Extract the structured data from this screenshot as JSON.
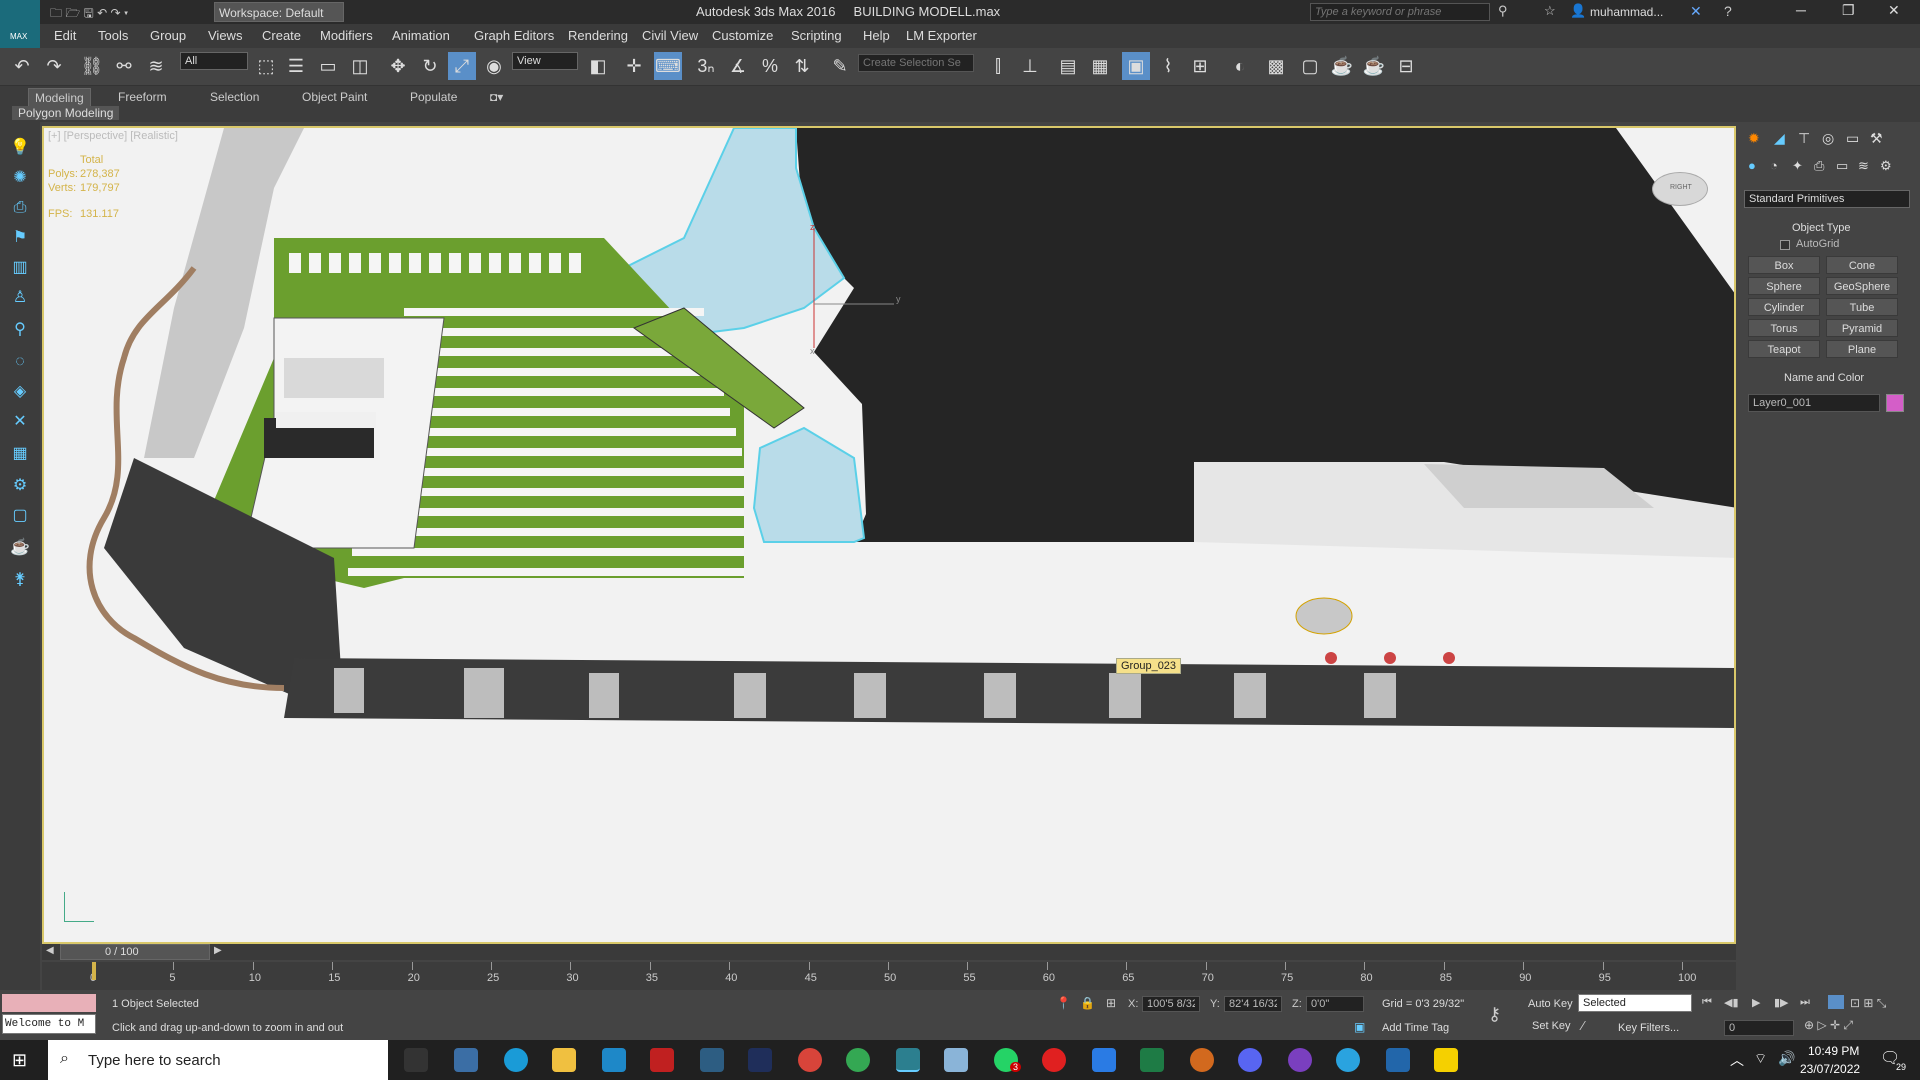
{
  "titlebar": {
    "workspace": "Workspace: Default",
    "title": "Autodesk 3ds Max 2016     BUILDING MODELL.max",
    "search_placeholder": "Type a keyword or phrase",
    "user": "muhammad...",
    "logo_text": "MAX"
  },
  "menu": [
    "Edit",
    "Tools",
    "Group",
    "Views",
    "Create",
    "Modifiers",
    "Animation",
    "Graph Editors",
    "Rendering",
    "Civil View",
    "Customize",
    "Scripting",
    "Help",
    "LM Exporter"
  ],
  "toolbar": {
    "filter_value": "All",
    "view_value": "View",
    "selection_set_placeholder": "Create Selection Se"
  },
  "ribbon": {
    "tabs": [
      "Modeling",
      "Freeform",
      "Selection",
      "Object Paint",
      "Populate"
    ],
    "sub_label": "Polygon Modeling"
  },
  "viewport": {
    "label": "[+] [Perspective] [Realistic]",
    "stats": {
      "total_label": "Total",
      "polys_label": "Polys:",
      "polys": "278,387",
      "verts_label": "Verts:",
      "verts": "179,797",
      "fps_label": "FPS:",
      "fps": "131.117"
    },
    "tooltip": "Group_023",
    "viewcube_label": "RIGHT",
    "axis_z": "z",
    "axis_y": "y",
    "axis_x": "x"
  },
  "cmdpanel": {
    "dropdown": "Standard Primitives",
    "object_type_title": "Object Type",
    "autogrid": "AutoGrid",
    "buttons": [
      "Box",
      "Cone",
      "Sphere",
      "GeoSphere",
      "Cylinder",
      "Tube",
      "Torus",
      "Pyramid",
      "Teapot",
      "Plane"
    ],
    "name_color_title": "Name and Color",
    "name_value": "Layer0_001",
    "color": "#d45ec8"
  },
  "timeline": {
    "frame": "0 / 100",
    "ticks": [
      "0",
      "5",
      "10",
      "15",
      "20",
      "25",
      "30",
      "35",
      "40",
      "45",
      "50",
      "55",
      "60",
      "65",
      "70",
      "75",
      "80",
      "85",
      "90",
      "95",
      "100"
    ]
  },
  "status": {
    "welcome": "Welcome to M",
    "selected": "1 Object Selected",
    "hint": "Click and drag up-and-down to zoom in and out",
    "x_label": "X:",
    "x_value": "100'5 8/32",
    "y_label": "Y:",
    "y_value": "82'4 16/32",
    "z_label": "Z:",
    "z_value": "0'0\"",
    "grid": "Grid = 0'3 29/32\"",
    "add_time_tag": "Add Time Tag",
    "auto_key": "Auto Key",
    "set_key": "Set Key",
    "selected_dropdown": "Selected",
    "key_filters": "Key Filters...",
    "frame_field": "0"
  },
  "taskbar": {
    "search_placeholder": "Type here to search",
    "time": "10:49 PM",
    "date": "23/07/2022",
    "notif_count": "29",
    "badge": "3"
  }
}
